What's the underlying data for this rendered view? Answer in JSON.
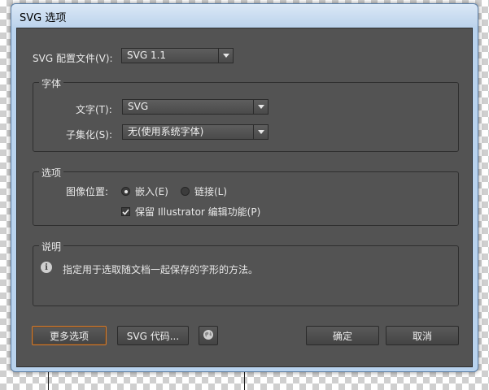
{
  "dialog": {
    "title": "SVG 选项"
  },
  "profile": {
    "label": "SVG 配置文件(V):",
    "value": "SVG 1.1"
  },
  "fonts_group": {
    "title": "字体",
    "type_label": "文字(T):",
    "type_value": "SVG",
    "subset_label": "子集化(S):",
    "subset_value": "无(使用系统字体)"
  },
  "options_group": {
    "title": "选项",
    "image_location_label": "图像位置:",
    "embed_label": "嵌入(E)",
    "link_label": "链接(L)",
    "selected": "embed",
    "preserve_label": "保留 Illustrator 编辑功能(P)",
    "preserve_checked": true
  },
  "description_group": {
    "title": "说明",
    "text": "指定用于选取随文档一起保存的字形的方法。"
  },
  "buttons": {
    "more_options": "更多选项",
    "svg_code": "SVG 代码...",
    "ok": "确定",
    "cancel": "取消"
  },
  "icons": {
    "web": "globe-icon",
    "info": "info-icon"
  }
}
